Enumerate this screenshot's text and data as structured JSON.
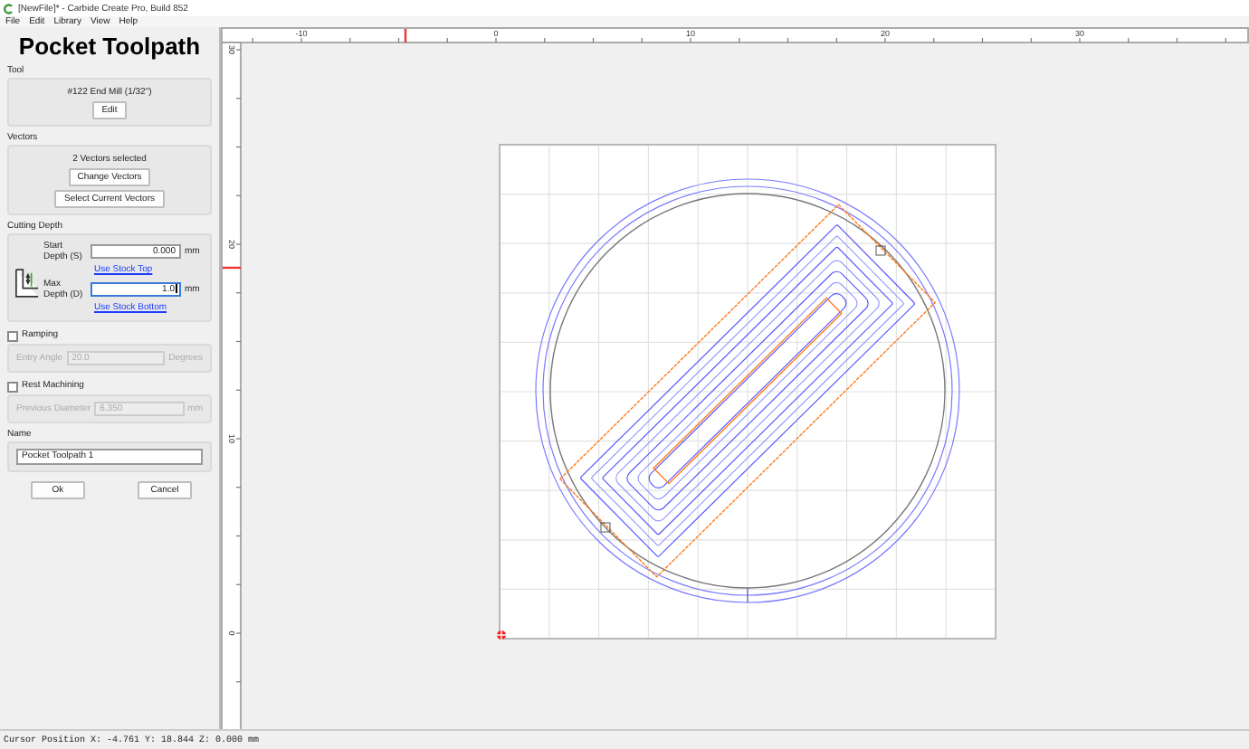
{
  "window": {
    "title": "[NewFile]* - Carbide Create Pro, Build 852"
  },
  "menu": [
    "File",
    "Edit",
    "Library",
    "View",
    "Help"
  ],
  "panel": {
    "title": "Pocket Toolpath",
    "tool": {
      "label": "Tool",
      "name": "#122 End Mill (1/32\")",
      "button": "Edit"
    },
    "vectors": {
      "label": "Vectors",
      "summary": "2 Vectors selected",
      "buttons": [
        "Change Vectors",
        "Select Current Vectors"
      ]
    },
    "cutting_depth": {
      "label": "Cutting Depth",
      "fields": [
        {
          "label": "Start Depth (S)",
          "value": "0.000",
          "unit": "mm",
          "link": "Use Stock Top",
          "focused": false
        },
        {
          "label": "Max Depth (D)",
          "value": "1.0",
          "unit": "mm",
          "link": "Use Stock Bottom",
          "focused": true
        }
      ]
    },
    "options": [
      {
        "label": "Ramping",
        "checked": false,
        "field_label": "Entry Angle",
        "value": "20.0",
        "unit": "Degrees"
      },
      {
        "label": "Rest Machining",
        "checked": false,
        "field_label": "Previous Diameter",
        "value": "6.350",
        "unit": "mm"
      }
    ],
    "name": {
      "label": "Name",
      "value": "Pocket Toolpath 1"
    },
    "buttons": [
      "Ok",
      "Cancel"
    ]
  },
  "rulers": {
    "horizontal": [
      "-10",
      "0",
      "10",
      "20",
      "30"
    ],
    "vertical": [
      "30",
      "20",
      "10",
      "0"
    ]
  },
  "status_bar": "Cursor Position X: -4.761 Y: 18.844 Z: 0.000 mm"
}
